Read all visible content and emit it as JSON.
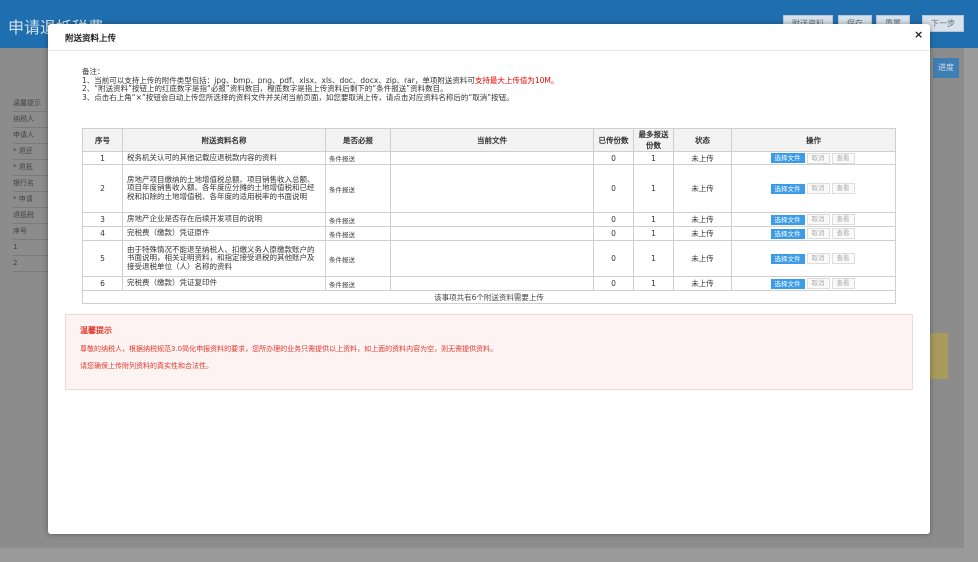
{
  "background": {
    "title": "申请退抵税费",
    "buttons": [
      "附送资料",
      "保存",
      "重置",
      "下一步"
    ],
    "side_button": "进度",
    "left_rows": [
      "温馨提示",
      "纳税人",
      "申请人",
      "* 退还",
      "* 退抵",
      "银行名",
      "* 申请",
      "退抵税",
      "序号",
      "1",
      "2"
    ]
  },
  "modal": {
    "title": "附送资料上传",
    "close": "×",
    "notes": {
      "heading": "备注：",
      "line1_pre": "1、当前可以支持上传的附件类型包括：jpg、bmp、png、pdf、xlsx、xls、doc、docx、zip、rar，单项附送资料可",
      "line1_red": "支持最大上传值为10M。",
      "line2": "2、“附送资料”按钮上的红底数字是指“必报”资料数目，橙底数字是指上传资料后剩下的“条件报送”资料数目。",
      "line3": "3、点击右上角“×”按钮会自动上传您所选择的资料文件并关闭当前页面，如您要取消上传，请点击对应资料名称后的“取消”按钮。"
    },
    "table": {
      "headers": [
        "序号",
        "附送资料名称",
        "是否必报",
        "当前文件",
        "已传份数",
        "最多报送份数",
        "状态",
        "操作"
      ],
      "rows": [
        {
          "no": "1",
          "name": "税务机关认可的其他记载应退税款内容的资料",
          "required": "条件报送",
          "file": "",
          "uploaded": "0",
          "max": "1",
          "status": "未上传"
        },
        {
          "no": "2",
          "name": "房地产项目缴纳的土地增值税总额、项目销售收入总额、项目年度销售收入额、各年度应分摊的土地增值税和已经税和扣除的土地增值税、各年度的适用税率的书面说明",
          "required": "条件报送",
          "file": "",
          "uploaded": "0",
          "max": "1",
          "status": "未上传"
        },
        {
          "no": "3",
          "name": "房地产企业是否存在后续开发项目的说明",
          "required": "条件报送",
          "file": "",
          "uploaded": "0",
          "max": "1",
          "status": "未上传"
        },
        {
          "no": "4",
          "name": "完税费（缴款）凭证原件",
          "required": "条件报送",
          "file": "",
          "uploaded": "0",
          "max": "1",
          "status": "未上传"
        },
        {
          "no": "5",
          "name": "由于特殊情况不能退至纳税人、扣缴义务人原缴款账户的书面说明，相关证明资料，和指定接受退税的其他账户及接受退税单位（人）名称的资料",
          "required": "条件报送",
          "file": "",
          "uploaded": "0",
          "max": "1",
          "status": "未上传"
        },
        {
          "no": "6",
          "name": "完税费（缴款）凭证复印件",
          "required": "条件报送",
          "file": "",
          "uploaded": "0",
          "max": "1",
          "status": "未上传"
        }
      ],
      "actions": {
        "select": "选择文件",
        "cancel": "取消",
        "view": "查看"
      },
      "footer": "该事项共有6个附送资料需要上传"
    },
    "tip": {
      "title": "温馨提示",
      "line1": "尊敬的纳税人，根据纳税规范3.0简化申报资料的要求，您所办理的业务只需提供以上资料，如上面的资料内容为空，则无需提供资料。",
      "line2": "请您确保上传附列资料的真实性和合法性。"
    }
  },
  "colors": {
    "header_blue": "#1f6fb0",
    "select_button": "#3c9be8",
    "tip_red": "#e03a2d",
    "note_red": "#e00000"
  }
}
